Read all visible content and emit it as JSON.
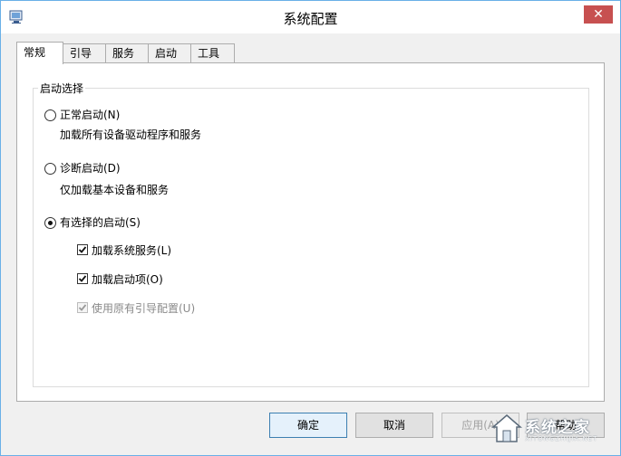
{
  "window": {
    "title": "系统配置",
    "close_glyph": "✕",
    "app_icon": "msconfig-icon"
  },
  "tabs": [
    {
      "label": "常规",
      "active": true
    },
    {
      "label": "引导",
      "active": false
    },
    {
      "label": "服务",
      "active": false
    },
    {
      "label": "启动",
      "active": false
    },
    {
      "label": "工具",
      "active": false
    }
  ],
  "startup_selection": {
    "legend": "启动选择",
    "normal": {
      "label": "正常启动(N)",
      "description": "加载所有设备驱动程序和服务",
      "checked": false
    },
    "diagnostic": {
      "label": "诊断启动(D)",
      "description": "仅加载基本设备和服务",
      "checked": false
    },
    "selective": {
      "label": "有选择的启动(S)",
      "checked": true
    },
    "options": {
      "load_system_services": {
        "label": "加载系统服务(L)",
        "checked": true
      },
      "load_startup_items": {
        "label": "加载启动项(O)",
        "checked": true
      },
      "use_original_boot": {
        "label": "使用原有引导配置(U)",
        "checked": true,
        "disabled": true
      }
    }
  },
  "buttons": {
    "ok": "确定",
    "cancel": "取消",
    "apply": "应用(A)",
    "help": "帮助"
  },
  "watermark": {
    "text": "系统之家",
    "sub": "XITONGZHIJIA.NET"
  }
}
